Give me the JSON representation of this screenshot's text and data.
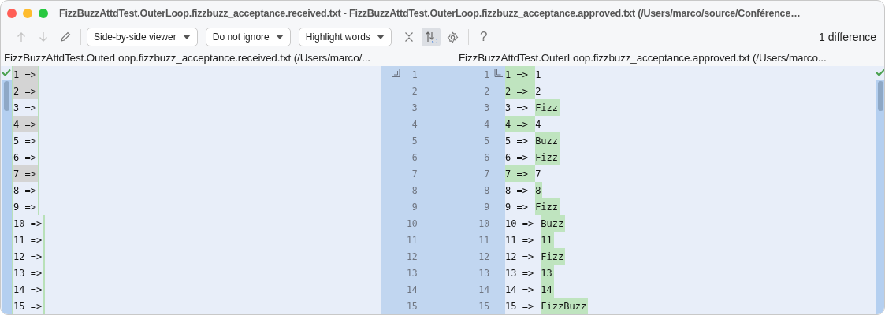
{
  "window": {
    "title": "FizzBuzzAttdTest.OuterLoop.fizzbuzz_acceptance.received.txt - FizzBuzzAttdTest.OuterLoop.fizzbuzz_acceptance.approved.txt (/Users/marco/source/Conférence…"
  },
  "toolbar": {
    "dropdowns": [
      {
        "label": "Side-by-side viewer"
      },
      {
        "label": "Do not ignore"
      },
      {
        "label": "Highlight words"
      }
    ],
    "sync_scroll_on": true,
    "help": "?",
    "status": "1 difference"
  },
  "left": {
    "header": "FizzBuzzAttdTest.OuterLoop.fizzbuzz_acceptance.received.txt (/Users/marco/...",
    "lines": [
      {
        "number": "1",
        "prefix": "1 =>",
        "highlighted": true
      },
      {
        "number": "2",
        "prefix": "2 =>",
        "highlighted": true
      },
      {
        "number": "3",
        "prefix": "3 =>",
        "highlighted": false
      },
      {
        "number": "4",
        "prefix": "4 =>",
        "highlighted": true
      },
      {
        "number": "5",
        "prefix": "5 =>",
        "highlighted": false
      },
      {
        "number": "6",
        "prefix": "6 =>",
        "highlighted": false
      },
      {
        "number": "7",
        "prefix": "7 =>",
        "highlighted": true
      },
      {
        "number": "8",
        "prefix": "8 =>",
        "highlighted": false
      },
      {
        "number": "9",
        "prefix": "9 =>",
        "highlighted": false
      },
      {
        "number": "10",
        "prefix": "10 =>",
        "highlighted": false
      },
      {
        "number": "11",
        "prefix": "11 =>",
        "highlighted": false
      },
      {
        "number": "12",
        "prefix": "12 =>",
        "highlighted": false
      },
      {
        "number": "13",
        "prefix": "13 =>",
        "highlighted": false
      },
      {
        "number": "14",
        "prefix": "14 =>",
        "highlighted": false
      },
      {
        "number": "15",
        "prefix": "15 =>",
        "highlighted": false
      }
    ]
  },
  "right": {
    "header": "FizzBuzzAttdTest.OuterLoop.fizzbuzz_acceptance.approved.txt (/Users/marco...",
    "lines": [
      {
        "number": "1",
        "prefix": "1 =>",
        "value": "1",
        "prefix_highlighted": true,
        "value_highlighted": false
      },
      {
        "number": "2",
        "prefix": "2 =>",
        "value": "2",
        "prefix_highlighted": true,
        "value_highlighted": false
      },
      {
        "number": "3",
        "prefix": "3 =>",
        "value": "Fizz",
        "prefix_highlighted": false,
        "value_highlighted": true
      },
      {
        "number": "4",
        "prefix": "4 =>",
        "value": "4",
        "prefix_highlighted": true,
        "value_highlighted": false
      },
      {
        "number": "5",
        "prefix": "5 =>",
        "value": "Buzz",
        "prefix_highlighted": false,
        "value_highlighted": true
      },
      {
        "number": "6",
        "prefix": "6 =>",
        "value": "Fizz",
        "prefix_highlighted": false,
        "value_highlighted": true
      },
      {
        "number": "7",
        "prefix": "7 =>",
        "value": "7",
        "prefix_highlighted": true,
        "value_highlighted": false
      },
      {
        "number": "8",
        "prefix": "8 =>",
        "value": "8",
        "prefix_highlighted": false,
        "value_highlighted": true
      },
      {
        "number": "9",
        "prefix": "9 =>",
        "value": "Fizz",
        "prefix_highlighted": false,
        "value_highlighted": true
      },
      {
        "number": "10",
        "prefix": "10 =>",
        "value": "Buzz",
        "prefix_highlighted": false,
        "value_highlighted": true
      },
      {
        "number": "11",
        "prefix": "11 =>",
        "value": "11",
        "prefix_highlighted": false,
        "value_highlighted": true
      },
      {
        "number": "12",
        "prefix": "12 =>",
        "value": "Fizz",
        "prefix_highlighted": false,
        "value_highlighted": true
      },
      {
        "number": "13",
        "prefix": "13 =>",
        "value": "13",
        "prefix_highlighted": false,
        "value_highlighted": true
      },
      {
        "number": "14",
        "prefix": "14 =>",
        "value": "14",
        "prefix_highlighted": false,
        "value_highlighted": true
      },
      {
        "number": "15",
        "prefix": "15 =>",
        "value": "FizzBuzz",
        "prefix_highlighted": false,
        "value_highlighted": true
      }
    ]
  }
}
